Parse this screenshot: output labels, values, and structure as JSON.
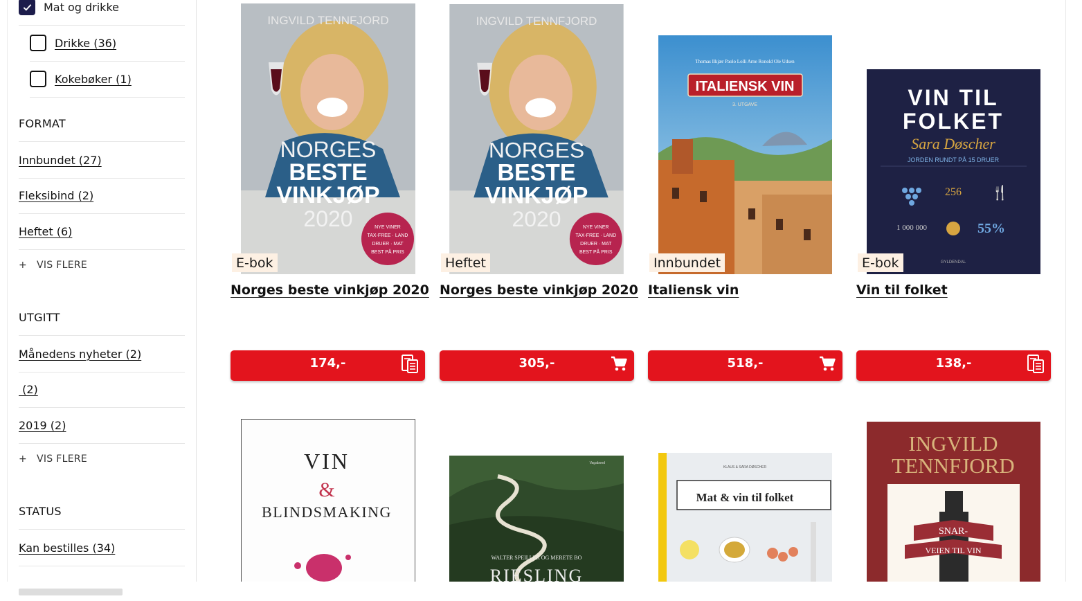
{
  "sidebar": {
    "category": {
      "label": "Mat og drikke",
      "children": [
        {
          "label": "Drikke (36)"
        },
        {
          "label": "Kokebøker (1)"
        }
      ]
    },
    "format": {
      "heading": "FORMAT",
      "items": [
        {
          "label": "Innbundet (27)"
        },
        {
          "label": "Fleksibind (2)"
        },
        {
          "label": "Heftet (6)"
        }
      ],
      "more": "VIS FLERE"
    },
    "utgitt": {
      "heading": "UTGITT",
      "items": [
        {
          "label": "Månedens nyheter (2)"
        },
        {
          "label": " (2)"
        },
        {
          "label": "2019 (2)"
        }
      ],
      "more": "VIS FLERE"
    },
    "status": {
      "heading": "STATUS",
      "items": [
        {
          "label": "Kan bestilles (34)"
        }
      ]
    },
    "plus_symbol": "+"
  },
  "products": [
    {
      "title": "Norges beste vinkjøp 2020",
      "format": "E-bok",
      "price": "174,-",
      "cart_icon": "ebook-icon",
      "cover": {
        "author": "INGVILD TENNFJORD",
        "line1": "NORGES",
        "line2": "BESTE",
        "line3": "VINKJØP",
        "line4": "2020",
        "sticker": [
          "NYE VINER",
          "TAX-FREE · LAND",
          "DRUER · MAT",
          "BEST PÅ PRIS"
        ]
      }
    },
    {
      "title": "Norges beste vinkjøp 2020",
      "format": "Heftet",
      "price": "305,-",
      "cart_icon": "cart-icon",
      "cover": {
        "author": "INGVILD TENNFJORD",
        "line1": "NORGES",
        "line2": "BESTE",
        "line3": "VINKJØP",
        "line4": "2020",
        "sticker": [
          "NYE VINER",
          "TAX-FREE · LAND",
          "DRUER · MAT",
          "BEST PÅ PRIS"
        ]
      }
    },
    {
      "title": "Italiensk vin",
      "format": "Innbundet",
      "price": "518,-",
      "cart_icon": "cart-icon",
      "cover": {
        "authors": "Thomas Ilkjær   Paolo Lolli   Arne Ronold   Ole Udsen",
        "title": "ITALIENSK VIN",
        "edition": "3. UTGAVE"
      }
    },
    {
      "title": "Vin til folket",
      "format": "E-bok",
      "price": "138,-",
      "cart_icon": "ebook-icon",
      "cover": {
        "line1": "VIN TIL",
        "line2": "FOLKET",
        "author": "Sara Døscher",
        "subtitle": "JORDEN RUNDT PÅ 15 DRUER",
        "stat1": "256",
        "stat2": "1 000 000",
        "stat3": "55%",
        "publisher": "GYLDENDAL"
      }
    },
    {
      "cover": {
        "line1": "VIN",
        "line2": "&",
        "line3": "BLINDSMAKING"
      }
    },
    {
      "cover": {
        "authors": "WALTER SPEILLER OG MERETE BO",
        "title": "RIESLING"
      }
    },
    {
      "cover": {
        "authors": "KLAUS & SARA DØSCHER",
        "title": "Mat & vin til folket"
      }
    },
    {
      "cover": {
        "line1": "INGVILD",
        "line2": "TENNFJORD",
        "banner1": "SNAR-",
        "banner2": "VEIEN TIL VIN"
      }
    }
  ],
  "colors": {
    "accent_red": "#e3141d",
    "badge_bg": "#fdf0e3",
    "check_navy": "#1c1c4b"
  }
}
